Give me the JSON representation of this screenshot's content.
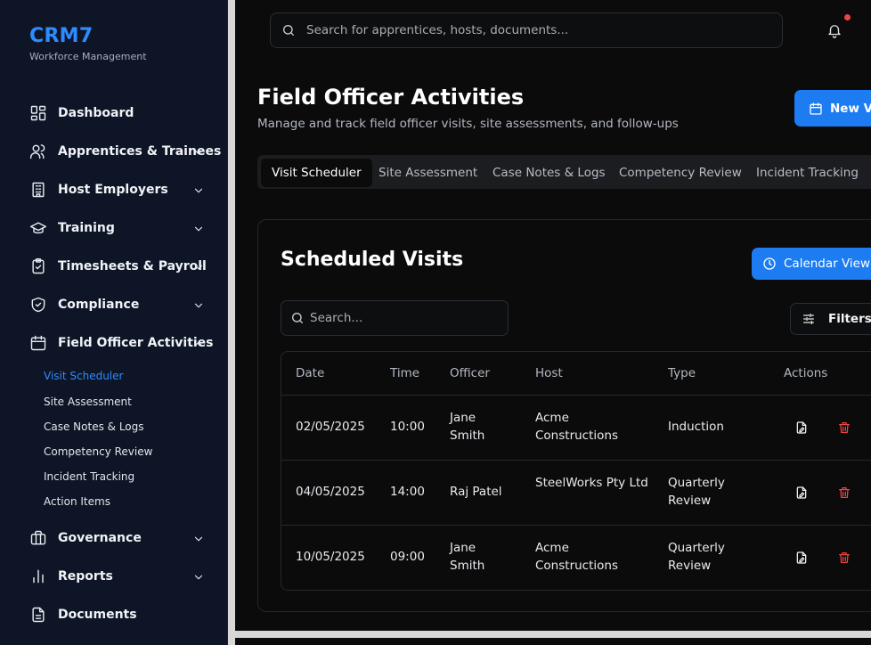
{
  "brand": {
    "title": "CRM7",
    "subtitle": "Workforce Management"
  },
  "sidebar": {
    "items": [
      {
        "label": "Dashboard",
        "icon": "grid-icon",
        "expandable": false
      },
      {
        "label": "Apprentices & Trainees",
        "icon": "users-icon",
        "expandable": true
      },
      {
        "label": "Host Employers",
        "icon": "building-icon",
        "expandable": true
      },
      {
        "label": "Training",
        "icon": "graduation-cap-icon",
        "expandable": true
      },
      {
        "label": "Timesheets & Payroll",
        "icon": "clipboard-check-icon",
        "expandable": true
      },
      {
        "label": "Compliance",
        "icon": "shield-check-icon",
        "expandable": true
      },
      {
        "label": "Field Officer Activities",
        "icon": "calendar-icon",
        "expandable": true,
        "expanded": true
      },
      {
        "label": "Governance",
        "icon": "briefcase-icon",
        "expandable": true
      },
      {
        "label": "Reports",
        "icon": "bar-chart-icon",
        "expandable": true
      },
      {
        "label": "Documents",
        "icon": "file-text-icon",
        "expandable": false
      }
    ],
    "subitems": [
      "Visit Scheduler",
      "Site Assessment",
      "Case Notes & Logs",
      "Competency Review",
      "Incident Tracking",
      "Action Items"
    ],
    "active_subitem": "Visit Scheduler"
  },
  "header": {
    "search_placeholder": "Search for apprentices, hosts, documents..."
  },
  "page": {
    "title": "Field Officer Activities",
    "subtitle": "Manage and track field officer visits, site assessments, and follow-ups",
    "new_button": "New Vi"
  },
  "tabs": [
    "Visit Scheduler",
    "Site Assessment",
    "Case Notes & Logs",
    "Competency Review",
    "Incident Tracking"
  ],
  "card": {
    "title": "Scheduled Visits",
    "calendar_button": "Calendar View",
    "search_placeholder": "Search...",
    "filters_button": "Filters"
  },
  "table": {
    "headers": [
      "Date",
      "Time",
      "Officer",
      "Host",
      "Type",
      "Actions"
    ],
    "rows": [
      {
        "date": "02/05/2025",
        "time": "10:00",
        "officer": "Jane Smith",
        "host": "Acme Constructions",
        "type": "Induction"
      },
      {
        "date": "04/05/2025",
        "time": "14:00",
        "officer": "Raj Patel",
        "host": "SteelWorks Pty Ltd",
        "type": "Quarterly Review"
      },
      {
        "date": "10/05/2025",
        "time": "09:00",
        "officer": "Jane Smith",
        "host": "Acme Constructions",
        "type": "Quarterly Review"
      }
    ]
  },
  "colors": {
    "accent": "#1d7cf2",
    "brand": "#2f8cff",
    "danger": "#ef4444",
    "sidebar_bg": "#0d1526"
  }
}
